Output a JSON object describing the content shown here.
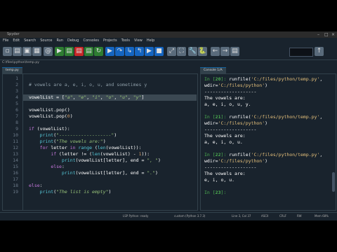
{
  "app": {
    "title": "Spyder"
  },
  "menu": [
    "File",
    "Edit",
    "Search",
    "Source",
    "Run",
    "Debug",
    "Consoles",
    "Projects",
    "Tools",
    "View",
    "Help"
  ],
  "toolbar": {
    "buttons": [
      {
        "name": "new-file-icon",
        "glyph": "▫",
        "color": "#5a6b7b"
      },
      {
        "name": "open-file-icon",
        "glyph": "▤",
        "color": "#5a6b7b"
      },
      {
        "name": "save-icon",
        "glyph": "▣",
        "color": "#5a6b7b"
      },
      {
        "name": "save-all-icon",
        "glyph": "▦",
        "color": "#5a6b7b"
      },
      {
        "name": "email-icon",
        "glyph": "@",
        "color": "#5a6b7b"
      },
      {
        "name": "run-icon",
        "glyph": "▶",
        "color": "#2e7d32"
      },
      {
        "name": "run-cell-icon",
        "glyph": "▤",
        "color": "#2e7d32"
      },
      {
        "name": "run-cell-advance-icon",
        "glyph": "▤",
        "color": "#c62828"
      },
      {
        "name": "run-selection-icon",
        "glyph": "▤",
        "color": "#2e7d32"
      },
      {
        "name": "rerun-icon",
        "glyph": "↻",
        "color": "#2e7d32"
      },
      {
        "name": "debug-icon",
        "glyph": "▶",
        "color": "#1565c0"
      },
      {
        "name": "step-icon",
        "glyph": "↷",
        "color": "#1565c0"
      },
      {
        "name": "step-into-icon",
        "glyph": "↳",
        "color": "#1565c0"
      },
      {
        "name": "step-return-icon",
        "glyph": "↰",
        "color": "#1565c0"
      },
      {
        "name": "continue-icon",
        "glyph": "▶",
        "color": "#1565c0"
      },
      {
        "name": "stop-debug-icon",
        "glyph": "■",
        "color": "#1565c0"
      },
      {
        "name": "maximize-icon",
        "glyph": "⤢",
        "color": "#5a6b7b"
      },
      {
        "name": "fullscreen-icon",
        "glyph": "⛶",
        "color": "#5a6b7b"
      },
      {
        "name": "preferences-icon",
        "glyph": "🔧",
        "color": "#5a6b7b"
      },
      {
        "name": "python-path-icon",
        "glyph": "🐍",
        "color": "#5a6b7b"
      },
      {
        "name": "back-icon",
        "glyph": "←",
        "color": "#5a6b7b"
      },
      {
        "name": "forward-icon",
        "glyph": "→",
        "color": "#5a6b7b"
      },
      {
        "name": "browse-folder-icon",
        "glyph": "▤",
        "color": "#5a6b7b"
      },
      {
        "name": "parent-dir-icon",
        "glyph": "↑",
        "color": "#5a6b7b"
      }
    ]
  },
  "filepath": "C:\\files\\python\\temp.py",
  "editor": {
    "tab": "temp.py",
    "lines": [
      {
        "n": "1",
        "html": ""
      },
      {
        "n": "2",
        "html": "<span class='cmt'># vowels are a, e, i, o, u, and sometimes y</span>"
      },
      {
        "n": "3",
        "html": ""
      },
      {
        "n": "4",
        "html": "vowelList = [<span class='str'>\"a\"</span>, <span class='str'>\"e\"</span>, <span class='str'>\"i\"</span>, <span class='str'>\"o\"</span>, <span class='str'>\"u\"</span>, <span class='str'>\"y\"</span>]"
      },
      {
        "n": "5",
        "html": ""
      },
      {
        "n": "6",
        "html": "vowelList.pop()"
      },
      {
        "n": "7",
        "html": "vowelList.pop(<span class='num'>0</span>)"
      },
      {
        "n": "8",
        "html": ""
      },
      {
        "n": "9",
        "html": "<span class='kw'>if</span> (vowelList):"
      },
      {
        "n": "10",
        "html": "    <span class='fn'>print</span>(<span class='str'>\"-------------------\"</span>)"
      },
      {
        "n": "11",
        "html": "    <span class='fn'>print</span>(<span class='str'>\"The vowels are:\"</span>)"
      },
      {
        "n": "12",
        "html": "    <span class='kw'>for</span> letter <span class='kw'>in</span> <span class='fn'>range</span> (<span class='fn'>len</span>(vowelList)):"
      },
      {
        "n": "13",
        "html": "        <span class='kw'>if</span> (letter != (<span class='fn'>len</span>(vowelList) - <span class='num'>1</span>)):"
      },
      {
        "n": "14",
        "html": "            <span class='fn'>print</span>(vowelList[letter], end = <span class='str'>\", \"</span>)"
      },
      {
        "n": "15",
        "html": "        <span class='kw'>else</span>:"
      },
      {
        "n": "16",
        "html": "            <span class='fn'>print</span>(vowelList[letter], end = <span class='str'>\".\"</span>)"
      },
      {
        "n": "17",
        "html": ""
      },
      {
        "n": "18",
        "html": "<span class='kw'>else</span>:"
      },
      {
        "n": "19",
        "html": "    <span class='fn'>print</span>(<span class='str'>\"The list is empty\"</span>)"
      }
    ]
  },
  "console": {
    "tab": "Console 1/A",
    "lines": [
      "<span class='prompt'>In [<b>20</b>]:</span> runfile(<span class='path'>'C:/files/python/temp.py'</span>,",
      "wdir=<span class='path'>'C:/files/python'</span>)",
      "-------------------",
      "The vowels are:",
      "a, e, i, o, u, y.",
      "",
      "<span class='prompt'>In [<b>21</b>]:</span> runfile(<span class='path'>'C:/files/python/temp.py'</span>,",
      "wdir=<span class='path'>'C:/files/python'</span>)",
      "-------------------",
      "The vowels are:",
      "a, e, i, o, u.",
      "",
      "<span class='prompt'>In [<b>22</b>]:</span> runfile(<span class='path'>'C:/files/python/temp.py'</span>,",
      "wdir=<span class='path'>'C:/files/python'</span>)",
      "-------------------",
      "The vowels are:",
      "e, i, o, u.",
      "",
      "<span class='prompt'>In [<b>23</b>]:</span>"
    ]
  },
  "status": {
    "lsp": "LSP Python: ready",
    "interpreter": "custom (Python 3.7.3)",
    "cursor": "Line 3, Col 37",
    "encoding": "ASCII",
    "eol": "CRLF",
    "rw": "RW",
    "mem": "Mem 68%"
  }
}
